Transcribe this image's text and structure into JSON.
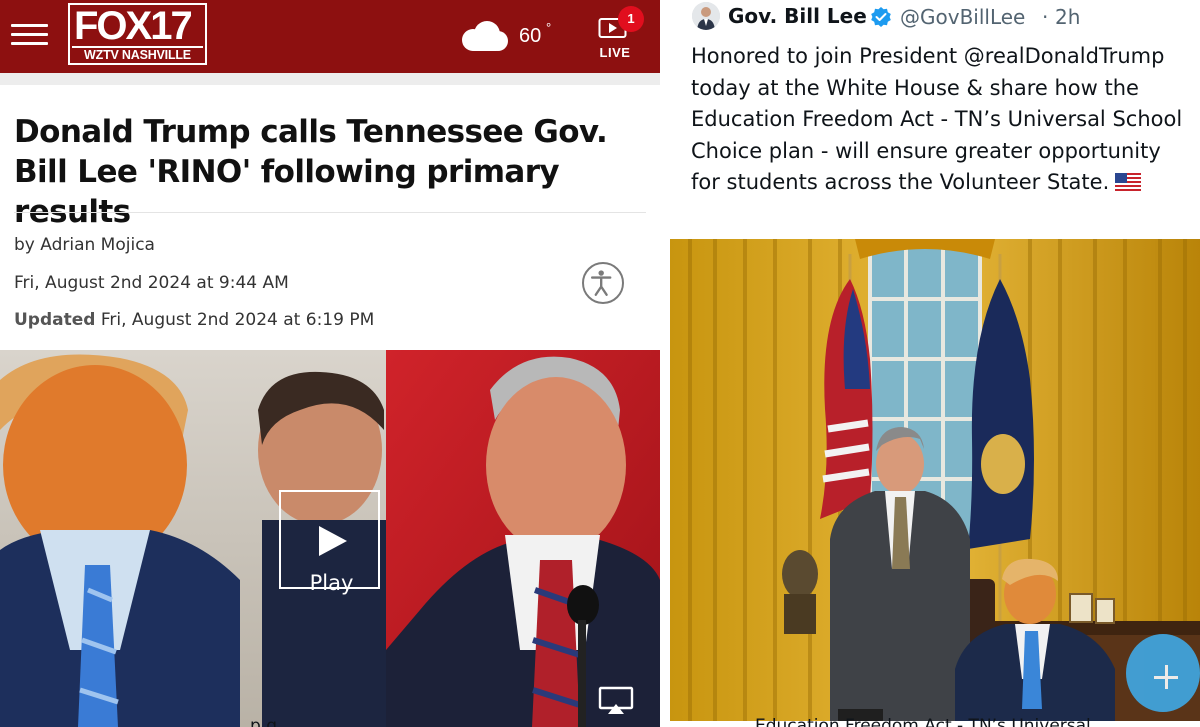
{
  "news": {
    "header": {
      "menu_icon": "hamburger-menu-icon",
      "logo_main": "FOX17",
      "logo_sub": "WZTV NASHVILLE",
      "weather_icon": "cloud-icon",
      "temperature": "60",
      "degree_symbol": "°",
      "live_badge_count": "1",
      "live_label": "LIVE",
      "colors": {
        "bar": "#8d1010",
        "badge": "#e10e1e"
      }
    },
    "article": {
      "headline": "Donald Trump calls Tennessee Gov. Bill Lee 'RINO' following primary results",
      "byline": "by Adrian Mojica",
      "date": "Fri, August 2nd 2024 at 9:44 AM",
      "updated_label": "Updated",
      "updated_date": "Fri, August 2nd 2024 at 6:19 PM",
      "accessibility_icon": "accessibility-icon"
    },
    "video": {
      "play_label": "Play",
      "airplay_icon": "airplay-icon"
    },
    "bottom_cut_text": "p                              g"
  },
  "tweet": {
    "name": "Gov. Bill Lee",
    "handle": "@GovBillLee",
    "separator": "·",
    "time": "2h",
    "text": "Honored to join President @realDonaldTrump today at the White House & share how the Education Freedom Act - TN’s Universal School Choice plan - will ensure greater opportunity for students across the Volunteer State.",
    "emoji": "us-flag-emoji",
    "verified_icon": "verified-badge-icon",
    "fab_icon": "plus-icon",
    "bottom_cut_text": "Education Freedom Act - TN’s Universal",
    "colors": {
      "verified": "#1d9bf0",
      "fab": "#3fa9e6"
    }
  }
}
